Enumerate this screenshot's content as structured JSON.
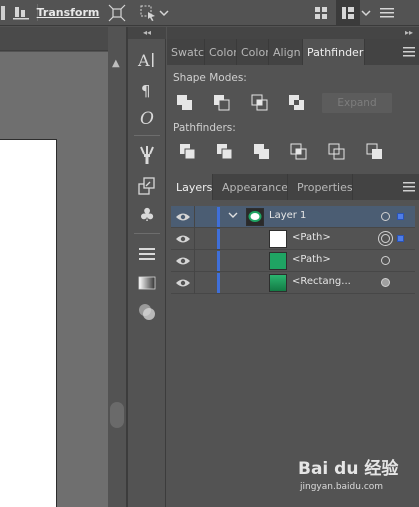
{
  "topbar": {
    "transform_label": "Transform"
  },
  "panel_group_top": {
    "tabs": [
      {
        "label": "Swatc",
        "active": false
      },
      {
        "label": "Color",
        "active": false
      },
      {
        "label": "Color",
        "active": false
      },
      {
        "label": "Align",
        "active": false
      },
      {
        "label": "Pathfinder",
        "active": true
      }
    ]
  },
  "pathfinder": {
    "shape_modes_label": "Shape Modes:",
    "pathfinders_label": "Pathfinders:",
    "expand_label": "Expand",
    "shape_mode_icons": [
      "unite-icon",
      "minus-front-icon",
      "intersect-icon",
      "exclude-icon"
    ],
    "pathfinder_icons": [
      "divide-icon",
      "trim-icon",
      "merge-icon",
      "crop-icon",
      "outline-icon",
      "minus-back-icon"
    ]
  },
  "panel_group_bottom": {
    "tabs": [
      {
        "label": "Layers",
        "active": true
      },
      {
        "label": "Appearance",
        "active": false
      },
      {
        "label": "Properties",
        "active": false
      }
    ]
  },
  "layers": {
    "rows": [
      {
        "name": "Layer 1",
        "kind": "layer",
        "thumb_color": "#1fa463",
        "selected": true
      },
      {
        "name": "<Path>",
        "kind": "path",
        "thumb_color": "#ffffff",
        "selected": false
      },
      {
        "name": "<Path>",
        "kind": "path",
        "thumb_color": "#1fa463",
        "selected": false
      },
      {
        "name": "<Rectang...",
        "kind": "rect",
        "thumb_color": "#1c9a5a",
        "selected": false
      }
    ]
  },
  "colors": {
    "accent": "#3f6fd9",
    "selected_row": "#4b5d73",
    "green": "#1fa463"
  },
  "watermark": {
    "brand": "Bai du 经验",
    "url": "jingyan.baidu.com"
  }
}
